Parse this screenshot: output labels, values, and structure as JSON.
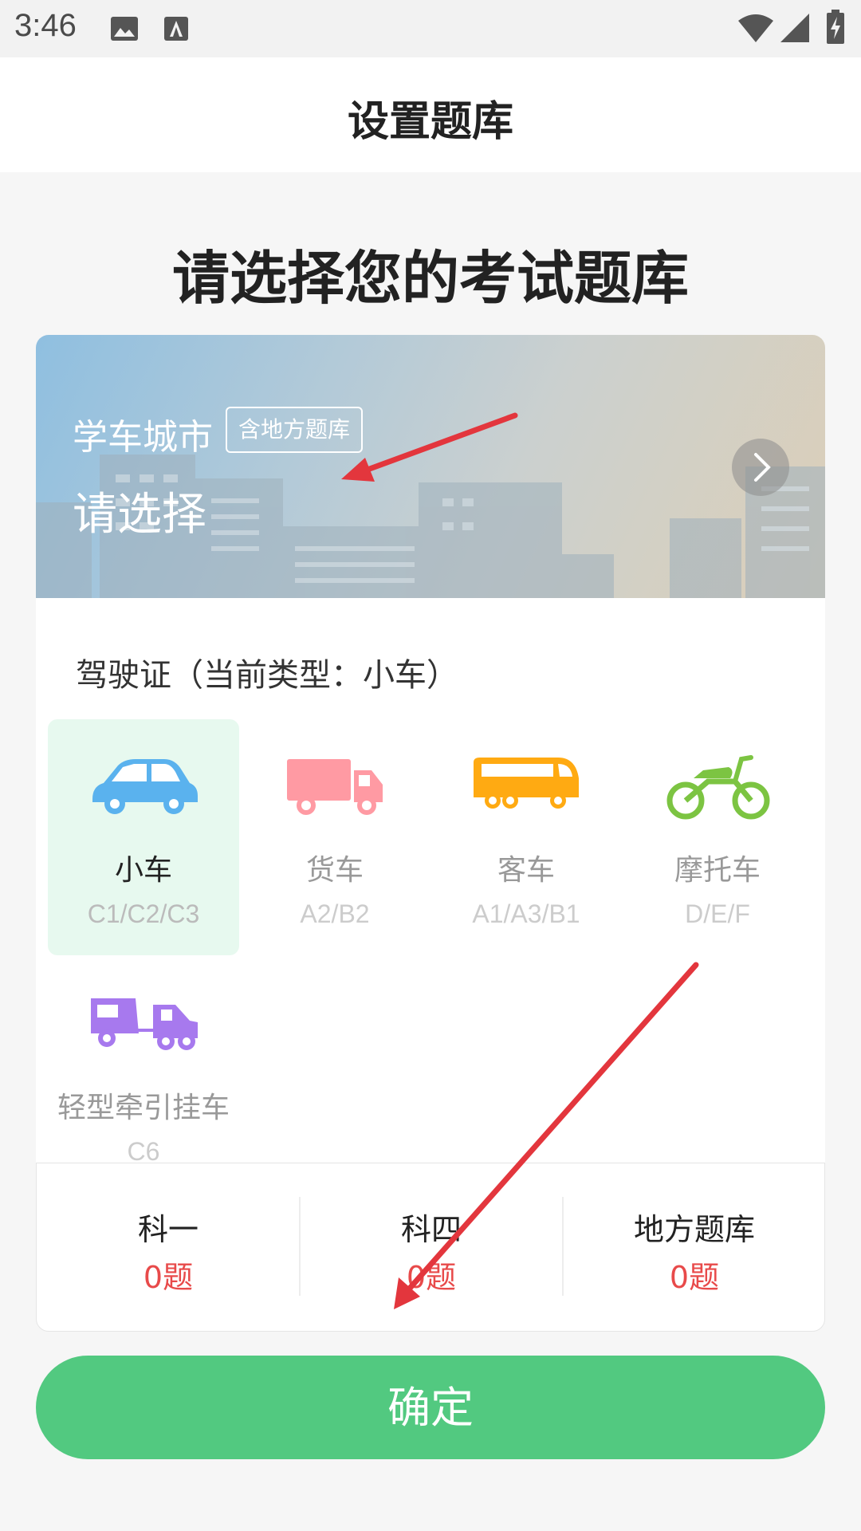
{
  "status_bar": {
    "time": "3:46"
  },
  "header": {
    "title": "设置题库"
  },
  "page": {
    "heading": "请选择您的考试题库"
  },
  "city": {
    "label": "学车城市",
    "tag": "含地方题库",
    "value": "请选择"
  },
  "license": {
    "title": "驾驶证（当前类型：小车）",
    "vehicles": [
      {
        "name": "小车",
        "code": "C1/C2/C3",
        "icon": "car-icon",
        "selected": true,
        "color": "#5ab2ee"
      },
      {
        "name": "货车",
        "code": "A2/B2",
        "icon": "truck-icon",
        "selected": false,
        "color": "#ff9aa3"
      },
      {
        "name": "客车",
        "code": "A1/A3/B1",
        "icon": "bus-icon",
        "selected": false,
        "color": "#ffaa12"
      },
      {
        "name": "摩托车",
        "code": "D/E/F",
        "icon": "motorcycle-icon",
        "selected": false,
        "color": "#7cc442"
      },
      {
        "name": "轻型牵引挂车",
        "code": "C6",
        "icon": "trailer-icon",
        "selected": false,
        "color": "#a779ee"
      }
    ]
  },
  "stats": [
    {
      "label": "科一",
      "count": "0题"
    },
    {
      "label": "科四",
      "count": "0题"
    },
    {
      "label": "地方题库",
      "count": "0题"
    }
  ],
  "confirm_label": "确定",
  "colors": {
    "accent_green": "#52c980",
    "count_red": "#e84a4a",
    "selected_bg": "#e7f9ef",
    "arrow_red": "#e3363d"
  }
}
